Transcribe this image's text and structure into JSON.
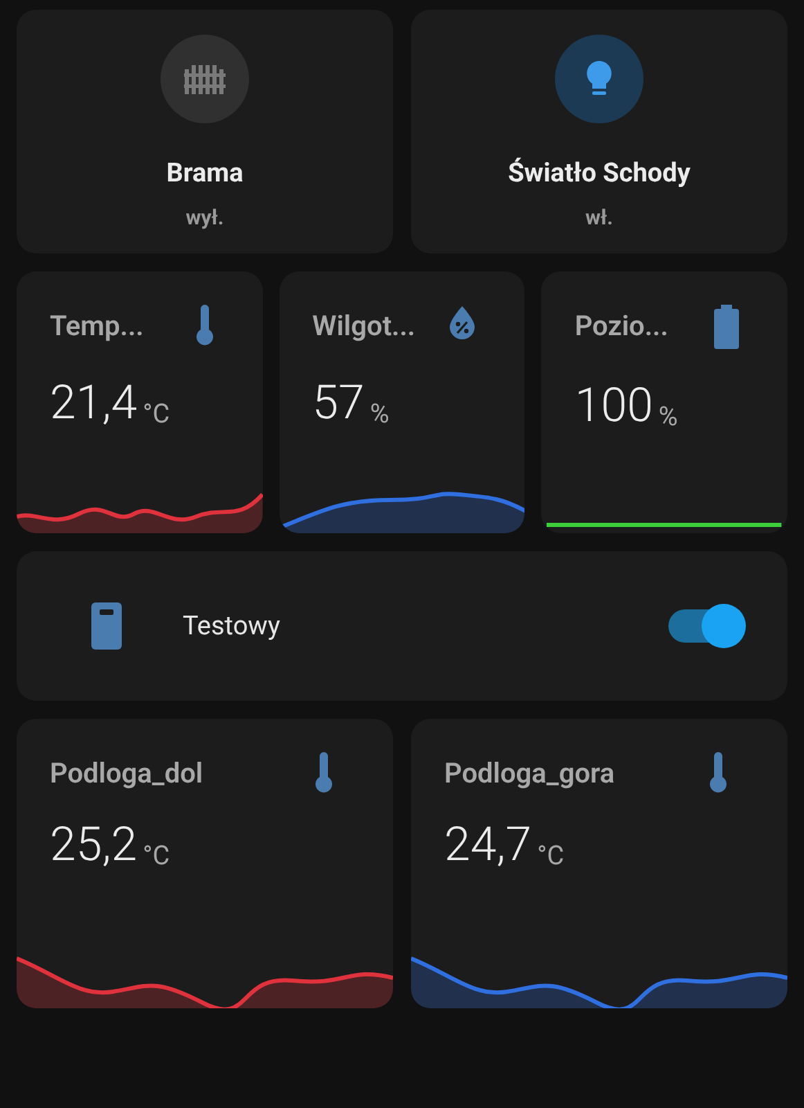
{
  "tiles": [
    {
      "kind": "gate",
      "name": "Brama",
      "state": "wył.",
      "on": false
    },
    {
      "kind": "bulb",
      "name": "Światło Schody",
      "state": "wł.",
      "on": true
    }
  ],
  "sensors_row": [
    {
      "kind": "thermometer",
      "title": "Temp...",
      "value": "21,4",
      "unit": "°C",
      "color": "#e0323c"
    },
    {
      "kind": "humidity",
      "title": "Wilgot...",
      "value": "57",
      "unit": "%",
      "color": "#2f6fe0"
    },
    {
      "kind": "battery",
      "title": "Pozio...",
      "value": "100",
      "unit": "%",
      "color": "#3ccf3c"
    }
  ],
  "switch_row": {
    "name": "Testowy",
    "on": true
  },
  "sensors_bottom": [
    {
      "kind": "thermometer",
      "title": "Podloga_dol",
      "value": "25,2",
      "unit": "°C",
      "color": "#e0323c"
    },
    {
      "kind": "thermometer",
      "title": "Podloga_gora",
      "value": "24,7",
      "unit": "°C",
      "color": "#2f6fe0"
    }
  ]
}
